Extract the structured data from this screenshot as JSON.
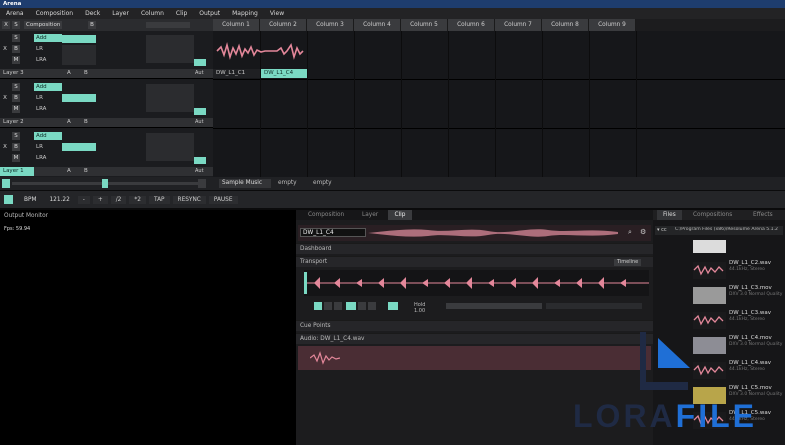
{
  "app": {
    "title": "Arena"
  },
  "menu": [
    "Arena",
    "Composition",
    "Deck",
    "Layer",
    "Column",
    "Clip",
    "Output",
    "Mapping",
    "View"
  ],
  "composition": {
    "label": "Composition",
    "mode_x": "X",
    "mode_s": "S",
    "btn_b": "B"
  },
  "columns": [
    "Column 1",
    "Column 2",
    "Column 3",
    "Column 4",
    "Column 5",
    "Column 6",
    "Column 7",
    "Column 8",
    "Column 9"
  ],
  "layers": [
    {
      "name": "Layer 3",
      "blend": "Add",
      "lr": "LR",
      "lrx": "LRA",
      "a": "A",
      "b": "B",
      "autopilot": "Aut"
    },
    {
      "name": "Layer 2",
      "blend": "Add",
      "lr": "LR",
      "lrx": "LRA",
      "a": "A",
      "b": "B",
      "autopilot": "Aut"
    },
    {
      "name": "Layer 1",
      "blend": "Add",
      "lr": "LR",
      "lrx": "LRA",
      "a": "A",
      "b": "B",
      "autopilot": "Aut"
    }
  ],
  "clips": [
    {
      "label": "DW_L1_C1",
      "active": false
    },
    {
      "label": "DW_L1_C4",
      "active": true
    }
  ],
  "decks": [
    "Sample Music",
    "empty",
    "empty"
  ],
  "transport": {
    "bpm_label": "BPM",
    "bpm_value": "121.22",
    "minus": "-",
    "plus": "+",
    "div2": "/2",
    "mul2": "*2",
    "tap": "TAP",
    "resync": "RESYNC",
    "pause": "PAUSE"
  },
  "output_monitor": {
    "title": "Output Monitor",
    "fps": "Fps: 59.94"
  },
  "clip_panel": {
    "tabs": [
      "Composition",
      "Layer",
      "Clip"
    ],
    "active_tab": "Clip",
    "clip_name": "DW_L1_C4",
    "dashboard": "Dashboard",
    "transport": "Transport",
    "timeline": "Timeline",
    "speed": "Hold 1.00",
    "cue_points": "Cue Points",
    "audio": "Audio: DW_L1_C4.wav"
  },
  "files_panel": {
    "tabs": [
      "Files",
      "Compositions",
      "Effects"
    ],
    "path": "C:/Program Files (x86)/Resolume Arena 5.1.2",
    "items": [
      {
        "name": "DW_L1_C2.wav",
        "meta": "44.1kHz, Stereo"
      },
      {
        "name": "DW_L1_C3.mov",
        "meta": "DXV 3.0 Normal Quality"
      },
      {
        "name": "DW_L1_C3.wav",
        "meta": "44.1kHz, Stereo"
      },
      {
        "name": "DW_L1_C4.mov",
        "meta": "DXV 3.0 Normal Quality"
      },
      {
        "name": "DW_L1_C4.wav",
        "meta": "44.1kHz, Stereo"
      },
      {
        "name": "DW_L1_C5.mov",
        "meta": "DXV 3.0 Normal Quality"
      },
      {
        "name": "DW_L1_C5.wav",
        "meta": "44.1kHz, Stereo"
      }
    ]
  },
  "watermark": {
    "text": "LORAFILE"
  },
  "colors": {
    "accent": "#7ad9c3",
    "waveform": "#e3879a",
    "clip_bg": "#4a2d34"
  }
}
